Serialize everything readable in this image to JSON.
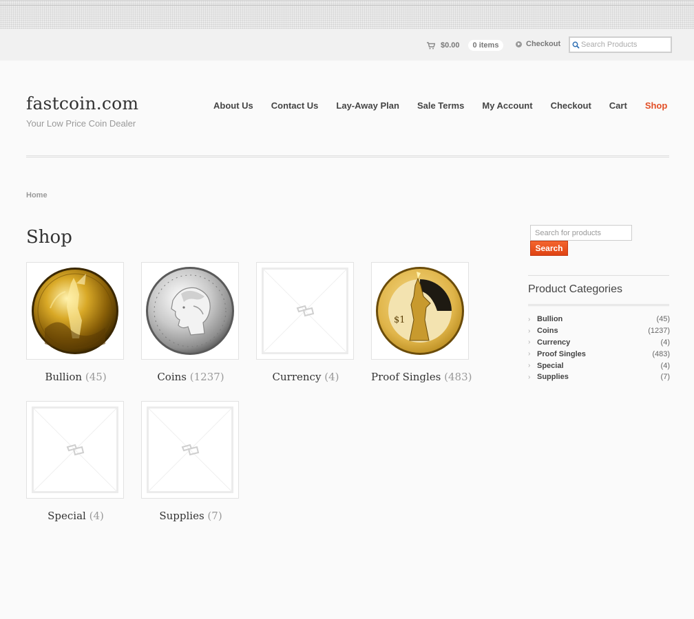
{
  "topbar": {
    "cart_total": "$0.00",
    "cart_count": "0 items",
    "checkout_label": "Checkout",
    "search_placeholder": "Search Products"
  },
  "site": {
    "title": "fastcoin.com",
    "tagline": "Your Low Price Coin Dealer"
  },
  "nav": {
    "items": [
      {
        "label": "About Us"
      },
      {
        "label": "Contact Us"
      },
      {
        "label": "Lay-Away Plan"
      },
      {
        "label": "Sale Terms"
      },
      {
        "label": "My Account"
      },
      {
        "label": "Checkout"
      },
      {
        "label": "Cart"
      },
      {
        "label": "Shop"
      }
    ],
    "active_color": "#e24e25"
  },
  "breadcrumb": "Home",
  "page_title": "Shop",
  "categories": [
    {
      "name": "Bullion",
      "count": "(45)",
      "image": "gold-eagle-coin"
    },
    {
      "name": "Coins",
      "count": "(1237)",
      "image": "silver-morgan-dollar"
    },
    {
      "name": "Currency",
      "count": "(4)",
      "image": "placeholder"
    },
    {
      "name": "Proof Singles",
      "count": "(483)",
      "image": "statue-of-liberty-dollar"
    },
    {
      "name": "Special",
      "count": "(4)",
      "image": "placeholder"
    },
    {
      "name": "Supplies",
      "count": "(7)",
      "image": "placeholder"
    }
  ],
  "sidebar": {
    "search_placeholder": "Search for products",
    "search_button": "Search",
    "widget_title": "Product Categories",
    "categories": [
      {
        "name": "Bullion",
        "count": "(45)"
      },
      {
        "name": "Coins",
        "count": "(1237)"
      },
      {
        "name": "Currency",
        "count": "(4)"
      },
      {
        "name": "Proof Singles",
        "count": "(483)"
      },
      {
        "name": "Special",
        "count": "(4)"
      },
      {
        "name": "Supplies",
        "count": "(7)"
      }
    ]
  },
  "colors": {
    "accent": "#e24e25",
    "button": "#f04f1c"
  }
}
